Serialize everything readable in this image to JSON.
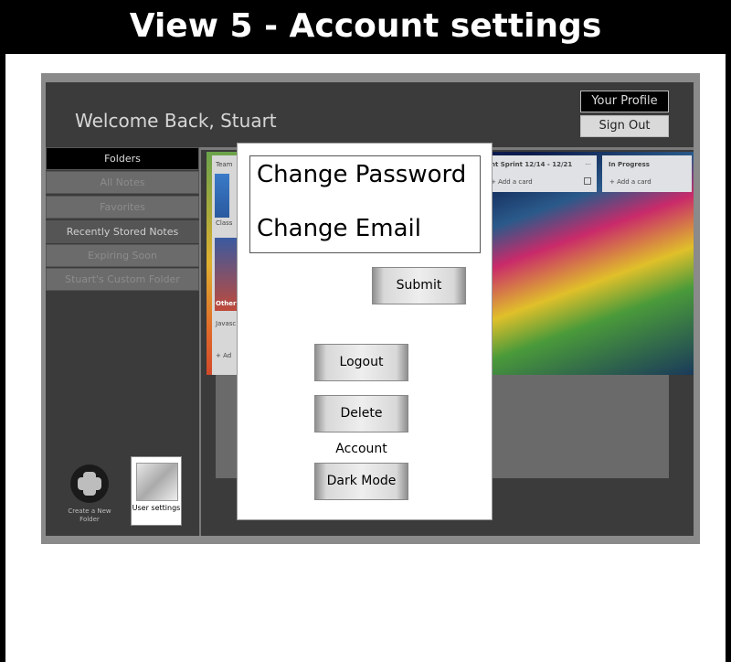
{
  "page_title": "View 5 - Account settings",
  "header": {
    "welcome": "Welcome Back, Stuart",
    "profile_label": "Your Profile",
    "signout_label": "Sign Out"
  },
  "sidebar": {
    "items": [
      {
        "label": "Folders"
      },
      {
        "label": "All Notes"
      },
      {
        "label": "Favorites"
      },
      {
        "label": "Recently Stored Notes"
      },
      {
        "label": "Expiring Soon"
      },
      {
        "label": "Stuart's Custom Folder"
      }
    ],
    "create_folder_label": "Create a New Folder",
    "user_settings_label": "User settings"
  },
  "board": {
    "col_team": "Team",
    "col_sprint": "nt Sprint 12/14 - 12/21",
    "col_progress": "In Progress",
    "add_card": "+ Add a card",
    "add_card_short": "+ Ad",
    "class_label": "Class",
    "other_label": "Other",
    "java_label": "Javasc",
    "more_icon": "...",
    "copy_icon": "copy-icon"
  },
  "modal": {
    "change_password": "Change Password",
    "change_email": "Change Email",
    "submit": "Submit",
    "logout": "Logout",
    "delete_account": "Delete Account",
    "dark_mode": "Dark Mode"
  }
}
